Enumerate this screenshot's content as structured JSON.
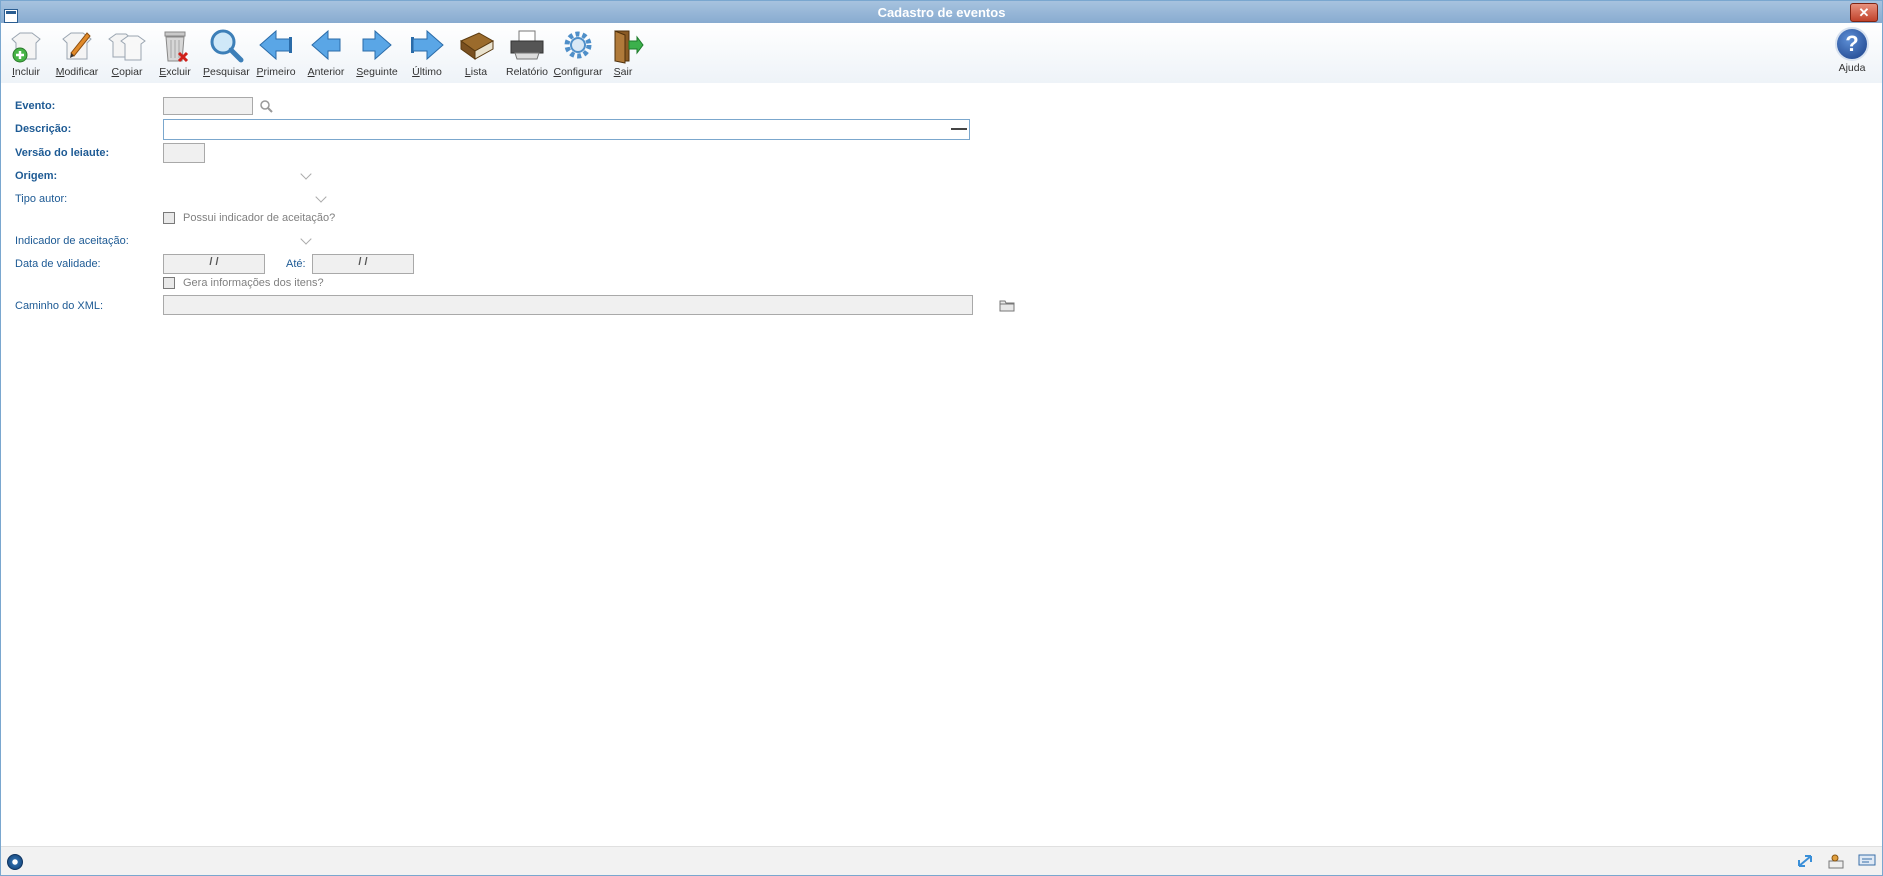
{
  "window": {
    "title": "Cadastro de eventos",
    "close_label": "✕"
  },
  "toolbar": {
    "buttons": [
      {
        "label": "Incluir",
        "icon": "add-icon"
      },
      {
        "label": "Modificar",
        "icon": "edit-icon"
      },
      {
        "label": "Copiar",
        "icon": "copy-icon"
      },
      {
        "label": "Excluir",
        "icon": "trash-icon"
      },
      {
        "label": "Pesquisar",
        "icon": "search-icon"
      },
      {
        "label": "Primeiro",
        "icon": "first-icon"
      },
      {
        "label": "Anterior",
        "icon": "previous-icon"
      },
      {
        "label": "Seguinte",
        "icon": "next-icon"
      },
      {
        "label": "Último",
        "icon": "last-icon"
      },
      {
        "label": "Lista",
        "icon": "book-icon"
      },
      {
        "label": "Relatório",
        "icon": "printer-icon"
      },
      {
        "label": "Configurar",
        "icon": "gear-icon"
      },
      {
        "label": "Sair",
        "icon": "exit-door-icon"
      }
    ],
    "help_label": "Ajuda",
    "help_glyph": "?"
  },
  "form": {
    "evento_label": "Evento:",
    "evento_value": "",
    "descricao_label": "Descrição:",
    "descricao_value": "",
    "versao_label": "Versão do leiaute:",
    "versao_value": "",
    "origem_label": "Origem:",
    "origem_value": "",
    "tipo_autor_label": "Tipo autor:",
    "tipo_autor_value": "",
    "possui_indicador_label": "Possui indicador de aceitação?",
    "indicador_label": "Indicador de aceitação:",
    "indicador_value": "",
    "data_validade_label": "Data de validade:",
    "data_inicio_value": "/ /",
    "ate_label": "Até:",
    "data_fim_value": "/ /",
    "gera_info_label": "Gera informações dos itens?",
    "caminho_label": "Caminho do XML:",
    "caminho_value": ""
  },
  "colors": {
    "label": "#1d5a94",
    "titlebar": "#88abd0",
    "accent": "#3a8fd8"
  }
}
